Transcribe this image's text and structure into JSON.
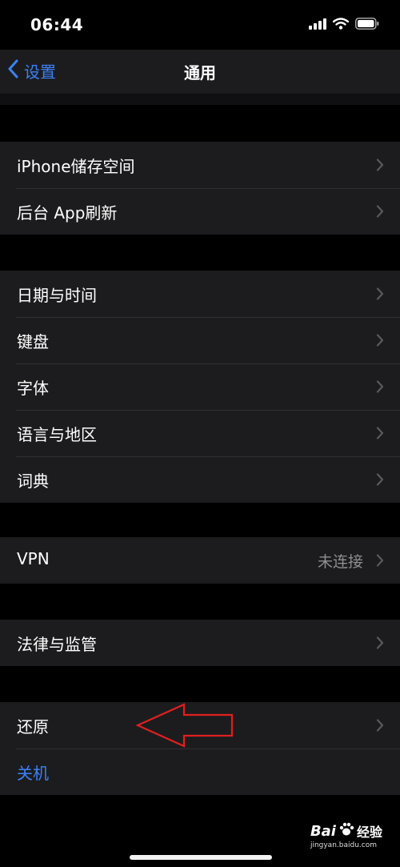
{
  "status_bar": {
    "time": "06:44"
  },
  "nav": {
    "back_label": "设置",
    "title": "通用"
  },
  "groups": [
    {
      "items": [
        {
          "label": "iPhone储存空间"
        },
        {
          "label": "后台 App刷新"
        }
      ]
    },
    {
      "items": [
        {
          "label": "日期与时间"
        },
        {
          "label": "键盘"
        },
        {
          "label": "字体"
        },
        {
          "label": "语言与地区"
        },
        {
          "label": "词典"
        }
      ]
    },
    {
      "items": [
        {
          "label": "VPN",
          "value": "未连接"
        }
      ]
    },
    {
      "items": [
        {
          "label": "法律与监管"
        }
      ]
    },
    {
      "items": [
        {
          "label": "还原"
        },
        {
          "label": "关机"
        }
      ]
    }
  ],
  "watermark": {
    "brand": "Bai",
    "brand_suffix": "经验",
    "url": "jingyan.baidu.com"
  },
  "colors": {
    "accent": "#3b82f6",
    "annotation_arrow": "#e02020",
    "cell_bg": "#1c1c1e",
    "page_bg": "#000000"
  }
}
